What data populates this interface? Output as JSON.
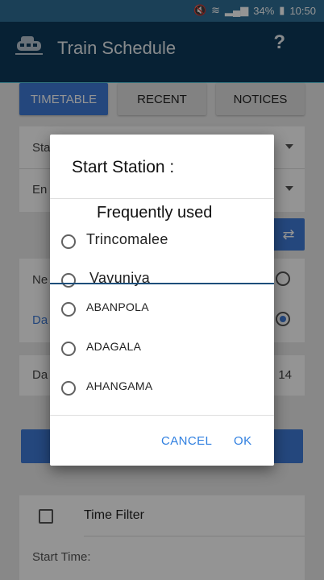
{
  "status_bar": {
    "battery": "34%",
    "time": "10:50"
  },
  "app_bar": {
    "title": "Train Schedule",
    "help_symbol": "?"
  },
  "tabs": [
    {
      "label": "TIMETABLE"
    },
    {
      "label": "RECENT"
    },
    {
      "label": "NOTICES"
    }
  ],
  "background": {
    "start_station_label": "Sta",
    "end_station_label": "En",
    "next_label": "Ne",
    "date_option_label": "Da",
    "date_label": "Da",
    "date_value_suffix": "14",
    "time_filter_label": "Time Filter",
    "start_time_label": "Start Time:"
  },
  "dialog": {
    "title": "Start Station :",
    "frequently_used_header": "Frequently used",
    "frequent_items": [
      "Trincomalee",
      "Vavuniya"
    ],
    "items": [
      "ABANPOLA",
      "ADAGALA",
      "AHANGAMA"
    ],
    "cancel_label": "CANCEL",
    "ok_label": "OK"
  },
  "colors": {
    "accent": "#3f7bd7",
    "app_bar": "#0d3a5a",
    "button_text": "#2f7fe0"
  }
}
